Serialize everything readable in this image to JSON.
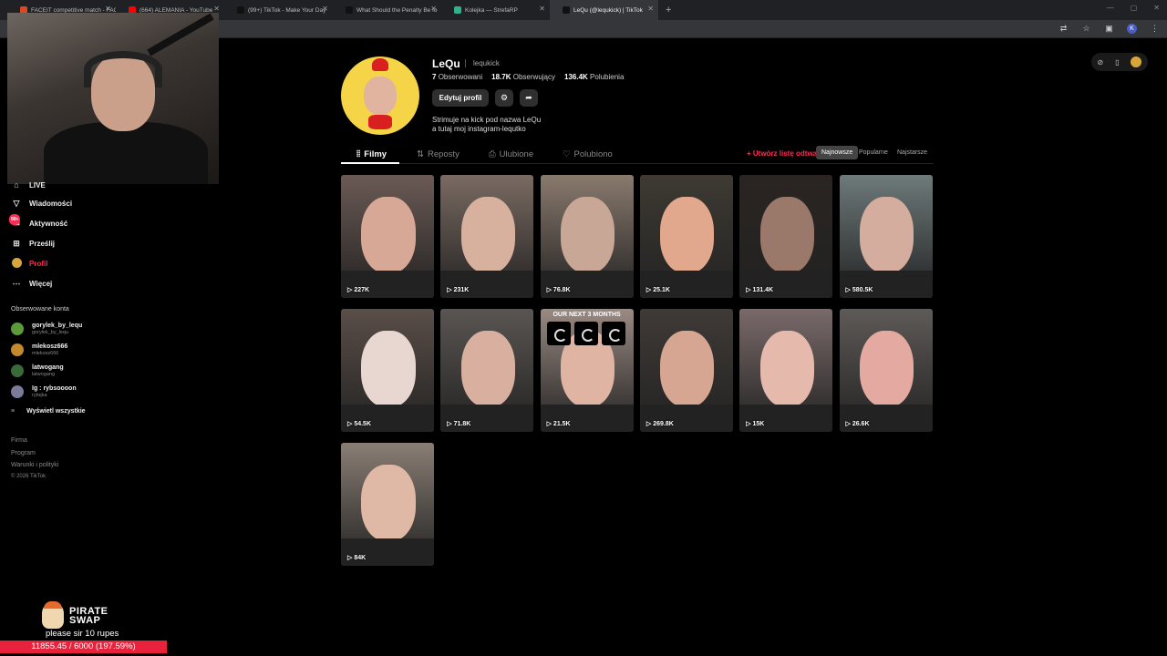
{
  "browser": {
    "tabs": [
      {
        "label": "FACEIT competitive match - FAC",
        "color": "#e2461f"
      },
      {
        "label": "(664) ALEMANIA - YouTube",
        "color": "#ff0000"
      },
      {
        "label": "(99+) TikTok - Make Your Day",
        "color": "#111111"
      },
      {
        "label": "What Should the Penalty Be fo",
        "color": "#111111"
      },
      {
        "label": "Kolejka — StrefaRP",
        "color": "#2fb38a"
      },
      {
        "label": "LeQu (@lequkick) | TikTok",
        "color": "#111111"
      }
    ],
    "new_tab": "+",
    "profile_initial": "K"
  },
  "sidebar": {
    "items": [
      {
        "label": "LIVE",
        "icon": "live-icon"
      },
      {
        "label": "Wiadomości",
        "icon": "send-icon"
      },
      {
        "label": "Aktywność",
        "icon": "inbox-icon",
        "badge": "99+"
      },
      {
        "label": "Prześlij",
        "icon": "plus-square-icon"
      },
      {
        "label": "Profil",
        "icon": "profile-avatar-icon"
      },
      {
        "label": "Więcej",
        "icon": "more-icon"
      }
    ],
    "following_title": "Obserwowane konta",
    "following": [
      {
        "name": "gorylek_by_lequ",
        "username": "gorylek_by_lequ",
        "color": "#5b9b3a"
      },
      {
        "name": "mlekosz666",
        "username": "mlekosz666",
        "color": "#c28a2a"
      },
      {
        "name": "latwogang",
        "username": "latwogang",
        "color": "#3a6a3a"
      },
      {
        "name": "Ig : rybsoooon",
        "username": "rybqka",
        "color": "#7a7a9a"
      }
    ],
    "show_all": "Wyświetl wszystkie",
    "footer": [
      "Firma",
      "Program",
      "Warunki i polityki"
    ],
    "copyright": "© 2026 TikTok"
  },
  "profile": {
    "name": "LeQu",
    "handle": "lequkick",
    "following_count": "7",
    "following_label": "Obserwowani",
    "followers_count": "18.7K",
    "followers_label": "Obserwujący",
    "likes_count": "136.4K",
    "likes_label": "Polubienia",
    "edit_button": "Edytuj profil",
    "bio_line1": "Strimuje na kick pod nazwa LeQu",
    "bio_line2": "a tutaj moj instagram-lequtko"
  },
  "tabs": {
    "videos": "Filmy",
    "reposts": "Reposty",
    "favorites": "Ulubione",
    "liked": "Polubiono",
    "create_list": "+ Utwórz listę odtwarzania",
    "sort": [
      "Najnowsze",
      "Popularne",
      "Najstarsze"
    ]
  },
  "videos": [
    {
      "views": "227K",
      "bg": "#6b5a55",
      "face": "#d7a896"
    },
    {
      "views": "231K",
      "bg": "#7a6a62",
      "face": "#d8b09e"
    },
    {
      "views": "76.8K",
      "bg": "#8a7a6e",
      "face": "#c9a797"
    },
    {
      "views": "25.1K",
      "bg": "#3e3a33",
      "face": "#e2a88e"
    },
    {
      "views": "131.4K",
      "bg": "#2a2522",
      "face": "#9a786a"
    },
    {
      "views": "580.5K",
      "bg": "#6e7a7a",
      "face": "#d5ad9e"
    },
    {
      "views": "54.5K",
      "bg": "#5a4e48",
      "face": "#e8d6d0"
    },
    {
      "views": "71.8K",
      "bg": "#5a5552",
      "face": "#d9b0a0"
    },
    {
      "views": "21.5K",
      "bg": "#9a8a82",
      "face": "#e0b4a2",
      "overlay": "OUR NEXT 3 MONTHS"
    },
    {
      "views": "269.8K",
      "bg": "#3f3a36",
      "face": "#d6a692"
    },
    {
      "views": "15K",
      "bg": "#7a6a6a",
      "face": "#e6b9ad"
    },
    {
      "views": "26.6K",
      "bg": "#5e5a58",
      "face": "#e4a9a0"
    },
    {
      "views": "84K",
      "bg": "#8a7e74",
      "face": "#e0b8a6"
    }
  ],
  "donation": {
    "brand_line1": "PIRATE",
    "brand_line2": "SWAP",
    "message": "please sir 10 rupes",
    "goal": "11855.45 / 6000 (197.59%)",
    "progress": 1.9759
  }
}
